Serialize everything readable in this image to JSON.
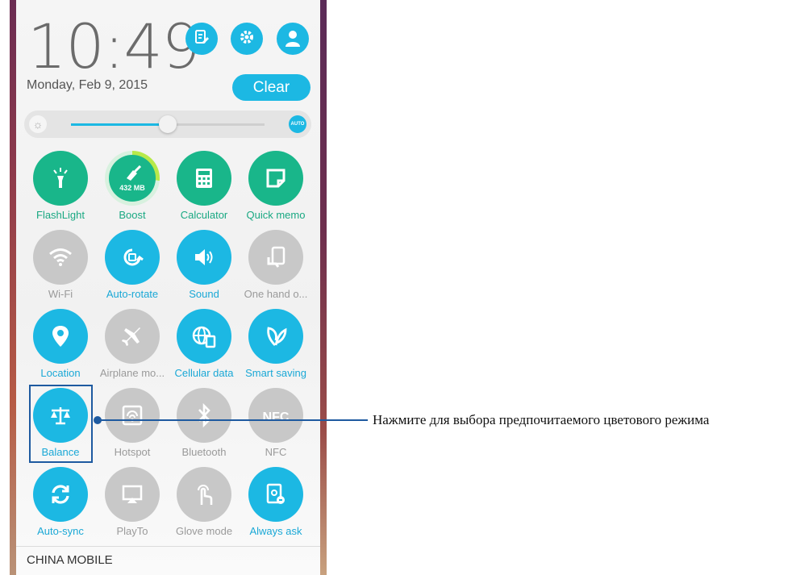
{
  "status": {
    "time": "10:49",
    "date": "Monday, Feb 9, 2015"
  },
  "header_icons": [
    {
      "icon": "edit-icon"
    },
    {
      "icon": "gear-icon"
    },
    {
      "icon": "user-icon"
    }
  ],
  "clear_label": "Clear",
  "brightness": {
    "level": 0.5,
    "auto_label": "AUTO"
  },
  "tiles": [
    {
      "label": "FlashLight",
      "state": "green",
      "icon": "flashlight-icon"
    },
    {
      "label": "Boost",
      "state": "boost",
      "icon": "broom-icon",
      "value": "432 MB"
    },
    {
      "label": "Calculator",
      "state": "green",
      "icon": "calculator-icon"
    },
    {
      "label": "Quick memo",
      "state": "green",
      "icon": "memo-icon"
    },
    {
      "label": "Wi-Fi",
      "state": "gray",
      "icon": "wifi-icon"
    },
    {
      "label": "Auto-rotate",
      "state": "blue",
      "icon": "rotate-icon"
    },
    {
      "label": "Sound",
      "state": "blue",
      "icon": "sound-icon"
    },
    {
      "label": "One hand o...",
      "state": "gray",
      "icon": "one-hand-icon"
    },
    {
      "label": "Location",
      "state": "blue",
      "icon": "location-icon"
    },
    {
      "label": "Airplane mo...",
      "state": "gray",
      "icon": "airplane-icon"
    },
    {
      "label": "Cellular data",
      "state": "blue",
      "icon": "cellular-data-icon"
    },
    {
      "label": "Smart saving",
      "state": "blue",
      "icon": "leaf-icon"
    },
    {
      "label": "Balance",
      "state": "blue",
      "icon": "balance-icon"
    },
    {
      "label": "Hotspot",
      "state": "gray",
      "icon": "hotspot-icon"
    },
    {
      "label": "Bluetooth",
      "state": "gray",
      "icon": "bluetooth-icon"
    },
    {
      "label": "NFC",
      "state": "gray",
      "icon": "nfc-icon"
    },
    {
      "label": "Auto-sync",
      "state": "blue",
      "icon": "sync-icon"
    },
    {
      "label": "PlayTo",
      "state": "gray",
      "icon": "playto-icon"
    },
    {
      "label": "Glove mode",
      "state": "gray",
      "icon": "glove-icon"
    },
    {
      "label": "Always ask",
      "state": "blue",
      "icon": "always-ask-icon"
    }
  ],
  "carrier": "CHINA MOBILE",
  "callout": "Нажмите для выбора предпочитаемого цветового режима",
  "colors": {
    "accent_blue": "#1cb8e3",
    "accent_green": "#19b68a",
    "disabled_gray": "#c8c8c8",
    "callout_line": "#1e5aa0"
  }
}
